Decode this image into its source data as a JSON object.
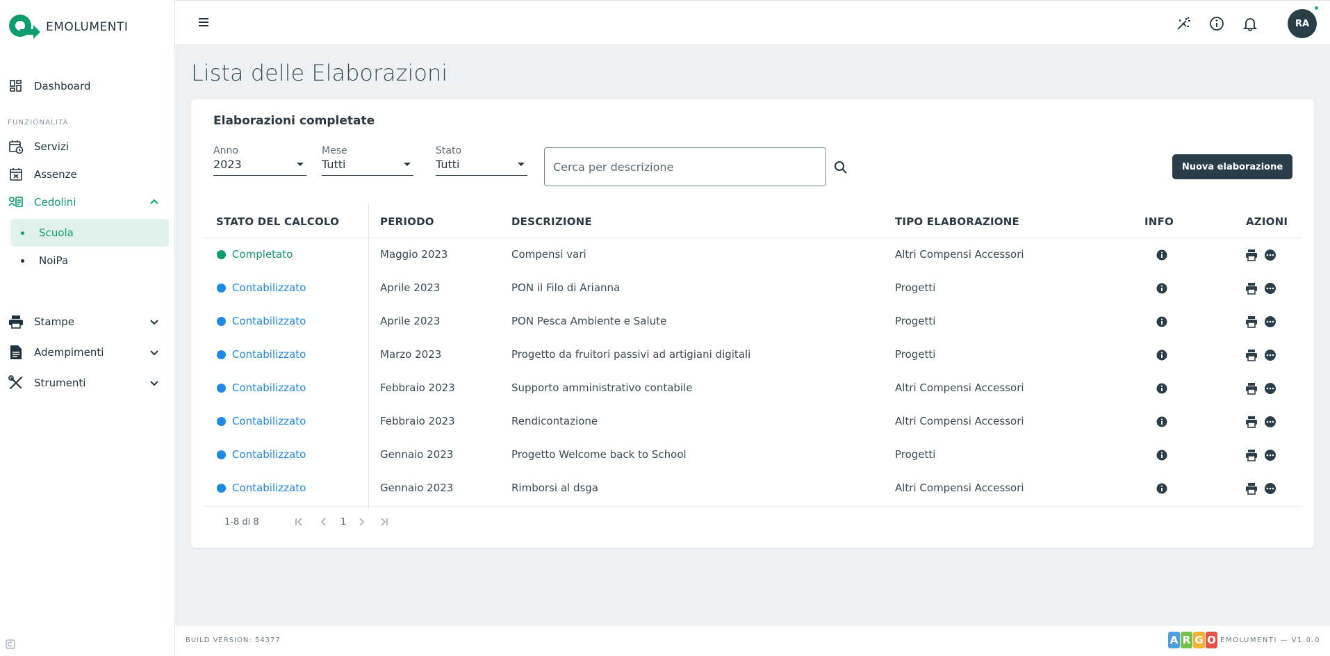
{
  "app": {
    "name": "EMOLUMENTI"
  },
  "sidebar": {
    "dashboard": "Dashboard",
    "section_label": "FUNZIONALITÀ",
    "items": [
      {
        "label": "Servizi",
        "icon": "calendar-clock-icon"
      },
      {
        "label": "Assenze",
        "icon": "calendar-x-icon"
      },
      {
        "label": "Cedolini",
        "icon": "payslip-icon",
        "expanded": true
      }
    ],
    "cedolini_sub": [
      {
        "label": "Scuola",
        "active": true
      },
      {
        "label": "NoiPa",
        "active": false
      }
    ],
    "groups": [
      {
        "label": "Stampe",
        "icon": "printer-icon"
      },
      {
        "label": "Adempimenti",
        "icon": "document-icon"
      },
      {
        "label": "Strumenti",
        "icon": "tools-icon"
      }
    ]
  },
  "topbar": {
    "avatar_initials": "RA"
  },
  "page": {
    "title": "Lista delle Elaborazioni"
  },
  "card": {
    "title": "Elaborazioni completate",
    "filters": {
      "anno": {
        "label": "Anno",
        "value": "2023"
      },
      "mese": {
        "label": "Mese",
        "value": "Tutti"
      },
      "stato": {
        "label": "Stato",
        "value": "Tutti"
      }
    },
    "search_placeholder": "Cerca per descrizione",
    "new_button": "Nuova elaborazione"
  },
  "table": {
    "headers": [
      "STATO DEL CALCOLO",
      "PERIODO",
      "DESCRIZIONE",
      "TIPO ELABORAZIONE",
      "INFO",
      "AZIONI"
    ],
    "rows": [
      {
        "stato": "Completato",
        "periodo": "Maggio 2023",
        "descrizione": "Compensi vari",
        "tipo": "Altri Compensi Accessori"
      },
      {
        "stato": "Contabilizzato",
        "periodo": "Aprile 2023",
        "descrizione": "PON il Filo di Arianna",
        "tipo": "Progetti"
      },
      {
        "stato": "Contabilizzato",
        "periodo": "Aprile 2023",
        "descrizione": "PON Pesca Ambiente e Salute",
        "tipo": "Progetti"
      },
      {
        "stato": "Contabilizzato",
        "periodo": "Marzo 2023",
        "descrizione": "Progetto da fruitori passivi ad artigiani digitali",
        "tipo": "Progetti"
      },
      {
        "stato": "Contabilizzato",
        "periodo": "Febbraio 2023",
        "descrizione": "Supporto amministrativo contabile",
        "tipo": "Altri Compensi Accessori"
      },
      {
        "stato": "Contabilizzato",
        "periodo": "Febbraio 2023",
        "descrizione": "Rendicontazione",
        "tipo": "Altri Compensi Accessori"
      },
      {
        "stato": "Contabilizzato",
        "periodo": "Gennaio 2023",
        "descrizione": "Progetto Welcome back to School",
        "tipo": "Progetti"
      },
      {
        "stato": "Contabilizzato",
        "periodo": "Gennaio 2023",
        "descrizione": "Rimborsi al dsga",
        "tipo": "Altri Compensi Accessori"
      }
    ],
    "status_colors": {
      "Completato": "#0e9d6e",
      "Contabilizzato": "#1e88e5"
    }
  },
  "pagination": {
    "range": "1-8 di 8",
    "page": "1"
  },
  "footer": {
    "build": "BUILD VERSION: 54377",
    "argo_letters": [
      "A",
      "R",
      "G",
      "O"
    ],
    "version": "EMOLUMENTI — V1.0.0"
  },
  "colors": {
    "accent": "#0e9d6e",
    "primary": "#2a3e4a",
    "link": "#1e88e5"
  }
}
